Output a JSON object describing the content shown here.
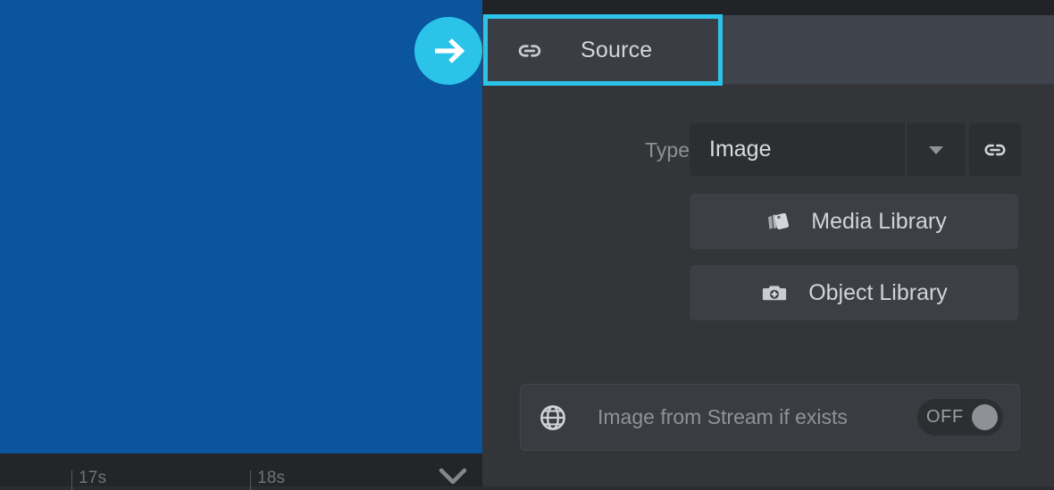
{
  "app": {
    "theme_bg": "#333538",
    "accent_highlight": "#2bc4e8",
    "preview_color": "#0a559e"
  },
  "left_pane": {
    "preview": {
      "name": "video-preview",
      "background": "#0a559e"
    },
    "timeline": {
      "ticks": [
        "17s",
        "18s"
      ],
      "collapse_icon": "chevron-down-icon"
    }
  },
  "right_pane": {
    "tabs": [
      {
        "label": "Source",
        "icon": "link-icon",
        "selected": true
      }
    ],
    "highlight": {
      "target": "Source",
      "color": "#2bc4e8",
      "arrow_icon": "arrow-right-icon"
    },
    "type_row": {
      "label": "Type",
      "value": "Image",
      "caret_icon": "caret-down-icon",
      "link_button_icon": "link-icon"
    },
    "library_buttons": [
      {
        "label": "Media Library",
        "icon": "media-stack-icon"
      },
      {
        "label": "Object Library",
        "icon": "camera-icon"
      }
    ],
    "stream_row": {
      "icon": "globe-icon",
      "label": "Image from Stream if exists",
      "toggle": {
        "state_label": "OFF",
        "on": false
      }
    }
  }
}
